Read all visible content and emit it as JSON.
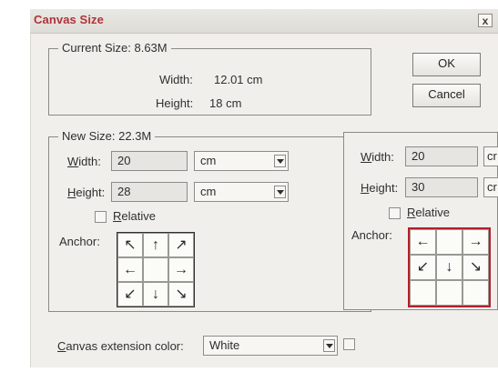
{
  "dialog": {
    "title": "Canvas Size",
    "close_label": "x",
    "buttons": {
      "ok": "OK",
      "cancel": "Cancel"
    }
  },
  "current_size": {
    "group_label": "Current Size: 8.63M",
    "width_label": "Width:",
    "width_value": "12.01 cm",
    "height_label": "Height:",
    "height_value": "18 cm"
  },
  "new_size": {
    "group_label": "New Size: 22.3M",
    "width_label": "Width:",
    "width_value": "20",
    "width_unit": "cm",
    "height_label": "Height:",
    "height_value": "28",
    "height_unit": "cm",
    "relative_label": "Relative",
    "anchor_label": "Anchor:",
    "anchor_arrows": [
      [
        "↖",
        "↑",
        "↗"
      ],
      [
        "←",
        "",
        "→"
      ],
      [
        "↙",
        "↓",
        "↘"
      ]
    ]
  },
  "overlay": {
    "width_label": "Width:",
    "width_value": "20",
    "width_unit_partial": "cr",
    "height_label": "Height:",
    "height_value": "30",
    "height_unit_partial": "cr",
    "relative_label": "Relative",
    "anchor_label": "Anchor:",
    "anchor_arrows": [
      [
        "←",
        "",
        "→"
      ],
      [
        "↙",
        "↓",
        "↘"
      ],
      [
        "",
        "",
        ""
      ]
    ]
  },
  "canvas_extension": {
    "label": "Canvas extension color:",
    "value": "White"
  }
}
